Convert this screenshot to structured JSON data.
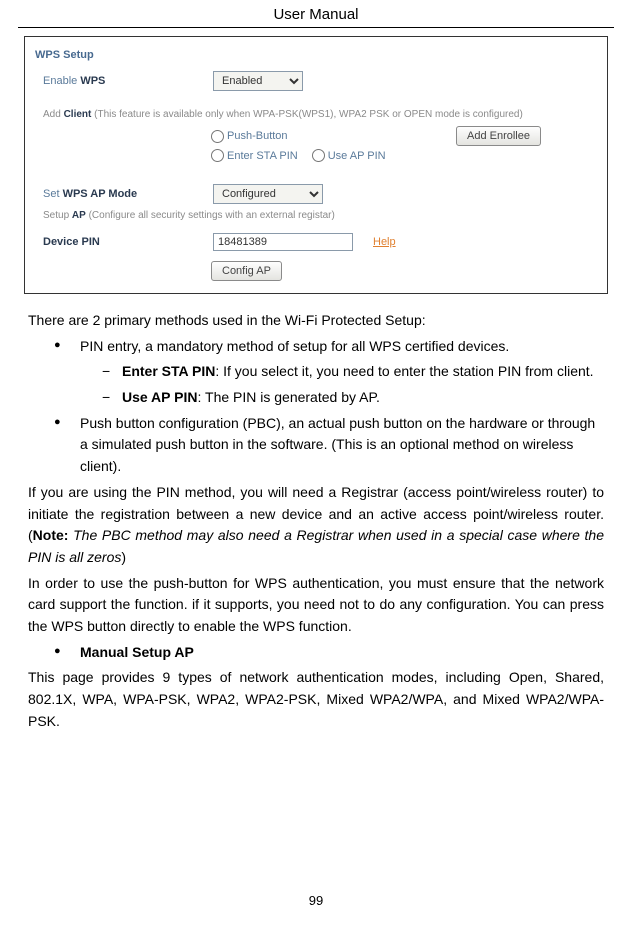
{
  "header": "User Manual",
  "page_number": "99",
  "screenshot": {
    "wps_setup_label": "WPS Setup",
    "enable_wps_label_pre": "Enable ",
    "enable_wps_label_bold": "WPS",
    "enable_wps_value": "Enabled",
    "add_client_pre": "Add ",
    "add_client_bold": "Client",
    "add_client_hint": " (This feature is available only when WPA-PSK(WPS1), WPA2 PSK or OPEN mode is configured)",
    "radio_push_button": "Push-Button",
    "radio_enter_sta_pin": "Enter STA PIN",
    "radio_use_ap_pin": "Use AP PIN",
    "add_enrollee_btn": "Add Enrollee",
    "set_wps_ap_pre": "Set ",
    "set_wps_ap_bold": "WPS AP Mode",
    "set_wps_ap_value": "Configured",
    "setup_ap_pre": "Setup ",
    "setup_ap_bold": "AP",
    "setup_ap_hint": " (Configure all security settings with an external registar)",
    "device_pin_label": "Device PIN",
    "device_pin_value": "18481389",
    "help_link": "Help",
    "config_ap_btn": "Config AP"
  },
  "content": {
    "intro": "There are 2 primary methods used in the Wi-Fi Protected Setup:",
    "bullet1": "PIN entry, a mandatory method of setup for all WPS certified devices.",
    "dash1_bold": "Enter STA PIN",
    "dash1_rest": ": If you select it, you need to enter the station PIN from client.",
    "dash2_bold": "Use AP PIN",
    "dash2_rest": ": The PIN is generated by AP.",
    "bullet2": "Push button configuration (PBC), an actual push button on the hardware or through a simulated push button in the software. (This is an optional method on wireless client).",
    "para1_pre": "If you are using the PIN method, you will need a Registrar (access point/wireless router) to initiate the registration between a new device and an active access point/wireless router. (",
    "para1_note": "Note:",
    "para1_italic": " The PBC method may also need a Registrar when used in a special case where the PIN is all zeros",
    "para1_post": ")",
    "para2": "In order to use the push-button for WPS authentication, you must ensure that the network card support the function. if it supports, you need not to do any configuration. You can press the WPS button directly to enable the WPS function.",
    "bullet3": "Manual Setup AP",
    "para3": "This page provides 9 types of network authentication modes, including Open, Shared, 802.1X, WPA, WPA-PSK, WPA2, WPA2-PSK, Mixed WPA2/WPA, and Mixed WPA2/WPA-PSK."
  }
}
